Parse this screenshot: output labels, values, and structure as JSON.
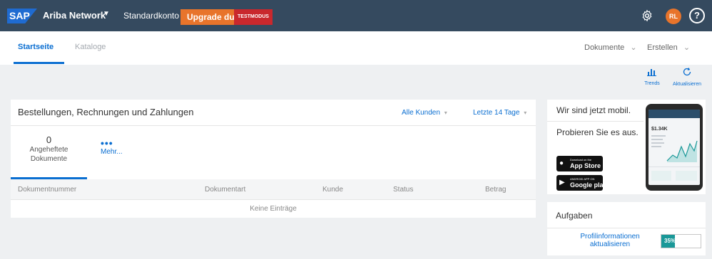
{
  "header": {
    "logo_text": "SAP",
    "app_name": "Ariba Network",
    "account": "Standardkonto",
    "upgrade_label": "Upgrade dur",
    "test_badge": "TESTMODUS",
    "avatar_initials": "RL",
    "help_glyph": "?",
    "colors": {
      "bar": "#354a5f",
      "upgrade": "#e8742b",
      "badge": "#c9282d",
      "accent": "#0a6ed1"
    }
  },
  "nav": {
    "tabs": [
      {
        "label": "Startseite",
        "active": true
      },
      {
        "label": "Kataloge",
        "active": false
      }
    ],
    "dropdowns": [
      {
        "label": "Dokumente"
      },
      {
        "label": "Erstellen"
      }
    ]
  },
  "actions": {
    "trends_label": "Trends",
    "refresh_label": "Aktualisieren"
  },
  "main_card": {
    "title": "Bestellungen, Rechnungen und Zahlungen",
    "filter_customers": "Alle Kunden",
    "filter_period": "Letzte 14 Tage",
    "pinned_count": "0",
    "pinned_label_1": "Angeheftete",
    "pinned_label_2": "Dokumente",
    "more_label": "Mehr...",
    "table": {
      "columns": [
        "Dokumentnummer",
        "Dokumentart",
        "Kunde",
        "Status",
        "Betrag"
      ],
      "empty_text": "Keine Einträge"
    }
  },
  "promo": {
    "title": "Wir sind jetzt mobil.",
    "text": "Probieren Sie es aus.",
    "apple_small": "Download on the",
    "apple_big": "App Store",
    "google_small": "ANDROID APP ON",
    "google_big": "Google play",
    "phone_amount": "$1.34K"
  },
  "tasks": {
    "title": "Aufgaben",
    "items": [
      {
        "line1": "Profilinformationen",
        "line2": "aktualisieren",
        "progress_percent": 35,
        "progress_label": "35%"
      }
    ]
  }
}
